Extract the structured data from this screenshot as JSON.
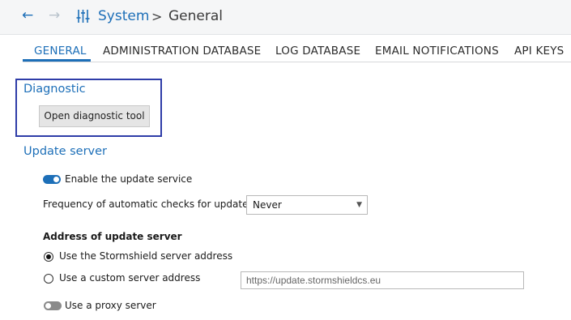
{
  "header": {
    "back_icon": "arrow-left-icon",
    "forward_icon": "arrow-right-icon",
    "section_icon": "sliders-icon",
    "breadcrumb": {
      "system": "System",
      "separator": ">",
      "current": "General"
    }
  },
  "tabs": [
    {
      "label": "GENERAL",
      "active": true
    },
    {
      "label": "ADMINISTRATION DATABASE",
      "active": false
    },
    {
      "label": "LOG DATABASE",
      "active": false
    },
    {
      "label": "EMAIL NOTIFICATIONS",
      "active": false
    },
    {
      "label": "API KEYS",
      "active": false
    }
  ],
  "diagnostic": {
    "title": "Diagnostic",
    "button_label": "Open diagnostic tool"
  },
  "update_server": {
    "title": "Update server",
    "enable_label": "Enable the update service",
    "enable_on": true,
    "frequency_label": "Frequency of automatic checks for updates",
    "frequency_value": "Never",
    "address_heading": "Address of update server",
    "option_stormshield": "Use the Stormshield server address",
    "option_custom": "Use a custom server address",
    "selected_option": "stormshield",
    "custom_placeholder": "https://update.stormshieldcs.eu",
    "proxy_label": "Use a proxy server",
    "proxy_on": false
  },
  "colors": {
    "accent": "#1d6fb8",
    "highlight_border": "#2f3da8"
  }
}
